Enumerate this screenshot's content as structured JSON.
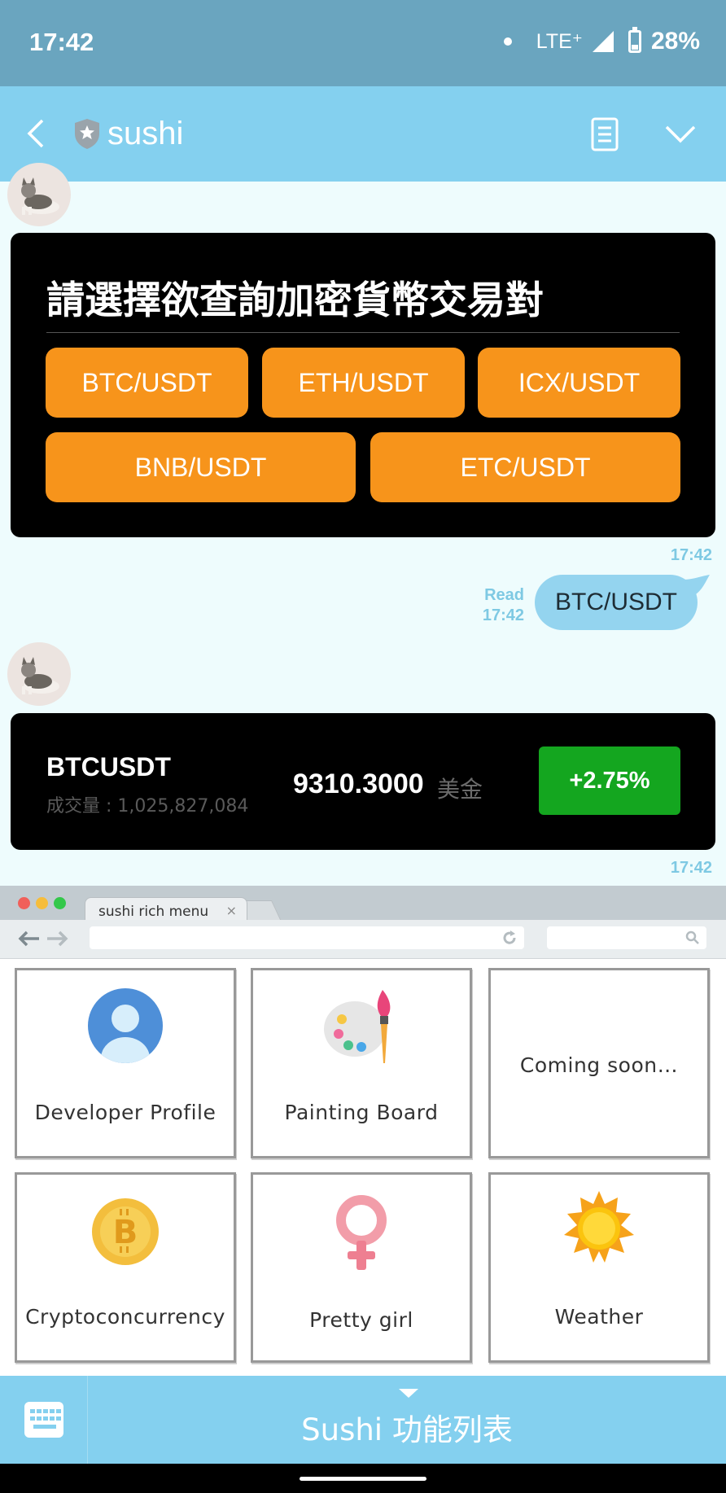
{
  "status_bar": {
    "time": "17:42",
    "network": "LTE⁺",
    "battery": "28%"
  },
  "header": {
    "title": "sushi"
  },
  "crypto_selector": {
    "heading": "請選擇欲查詢加密貨幣交易對",
    "options": [
      "BTC/USDT",
      "ETH/USDT",
      "ICX/USDT",
      "BNB/USDT",
      "ETC/USDT"
    ],
    "time": "17:42"
  },
  "user_message": {
    "text": "BTC/USDT",
    "read_label": "Read",
    "time": "17:42"
  },
  "ticker": {
    "symbol": "BTCUSDT",
    "volume": "成交量 : 1,025,827,084",
    "price": "9310.3000",
    "unit": "美金",
    "change": "+2.75%",
    "change_color": "#14a61f",
    "time": "17:42"
  },
  "rich_menu": {
    "tab_title": "sushi rich menu",
    "tiles": [
      {
        "label": "Developer Profile",
        "icon": "user-profile-icon"
      },
      {
        "label": "Painting Board",
        "icon": "palette-icon"
      },
      {
        "label": "Coming soon…",
        "icon": ""
      },
      {
        "label": "Cryptoconcurrency",
        "icon": "bitcoin-icon"
      },
      {
        "label": "Pretty girl",
        "icon": "female-symbol-icon"
      },
      {
        "label": "Weather",
        "icon": "sun-icon"
      }
    ]
  },
  "bottom_bar": {
    "menu_label": "Sushi 功能列表"
  },
  "colors": {
    "header": "#84d0ef",
    "accent_orange": "#f7941b",
    "status_bar": "#6aa5bf"
  }
}
